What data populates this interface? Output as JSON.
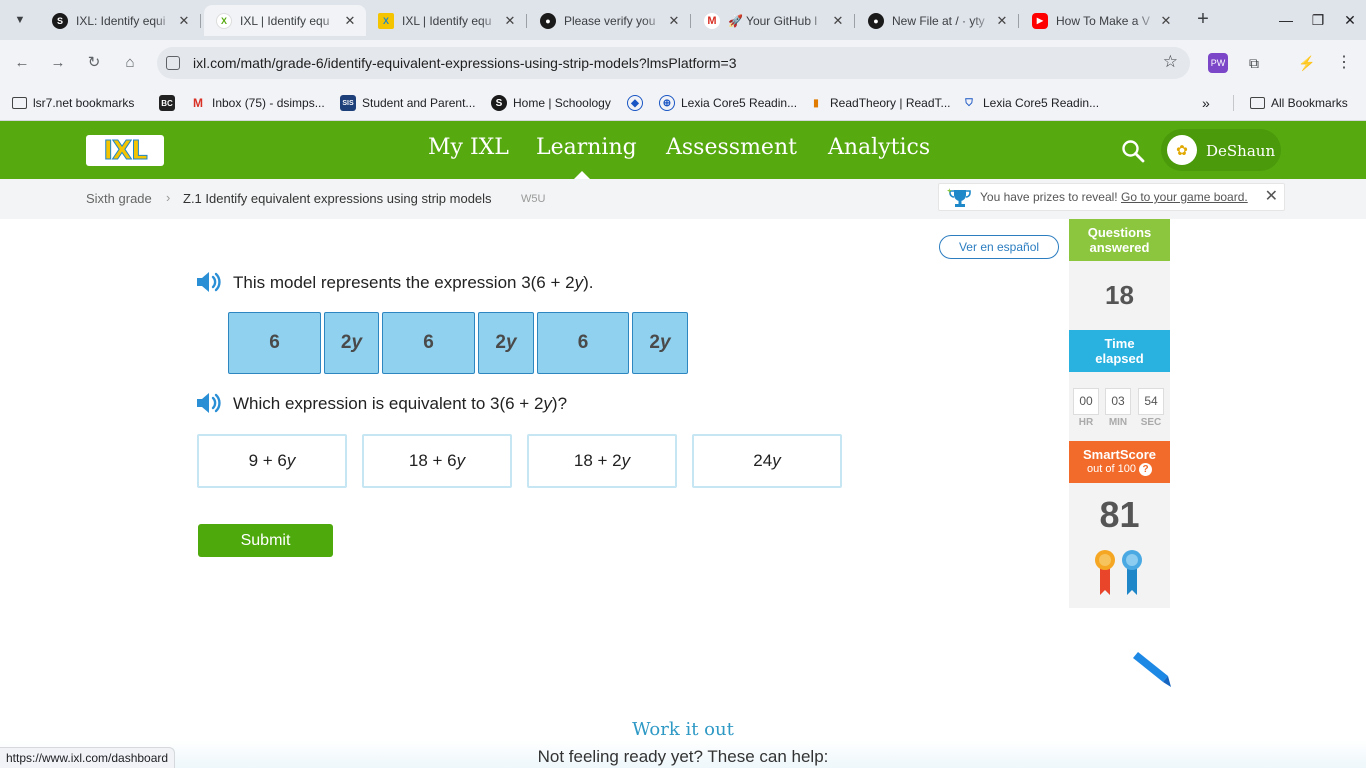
{
  "browser": {
    "tabs": [
      {
        "title": "IXL: Identify equi",
        "icon": "schoology-icon"
      },
      {
        "title": "IXL | Identify equ",
        "icon": "ixl-icon"
      },
      {
        "title": "IXL | Identify equ",
        "icon": "ixl-icon"
      },
      {
        "title": "Please verify you",
        "icon": "github-icon"
      },
      {
        "title": "🚀 Your GitHub l",
        "icon": "gmail-icon"
      },
      {
        "title": "New File at / · yty",
        "icon": "github-icon"
      },
      {
        "title": "How To Make a V",
        "icon": "youtube-icon"
      }
    ],
    "url": "ixl.com/math/grade-6/identify-equivalent-expressions-using-strip-models?lmsPlatform=3",
    "bookmarks": [
      "lsr7.net bookmarks",
      "Inbox (75) - dsimps...",
      "Student and Parent...",
      "Home | Schoology",
      "Lexia Core5 Readin...",
      "ReadTheory | ReadT...",
      "Lexia Core5 Readin..."
    ],
    "all_bookmarks": "All Bookmarks",
    "status_url": "https://www.ixl.com/dashboard"
  },
  "ixl": {
    "logo": "IXL",
    "nav": [
      "My IXL",
      "Learning",
      "Assessment",
      "Analytics"
    ],
    "active_nav": "Learning",
    "user_name": "DeShaun",
    "breadcrumb": {
      "grade": "Sixth grade",
      "skill": "Z.1 Identify equivalent expressions using strip models",
      "code": "W5U"
    },
    "prize": {
      "text": "You have prizes to reveal!",
      "link": "Go to your game board."
    },
    "espanol": "Ver en español"
  },
  "question": {
    "prompt_pre": "This model represents the expression 3(6 + 2",
    "prompt_var": "y",
    "prompt_post": ").",
    "strip": [
      {
        "num": "6",
        "var": ""
      },
      {
        "num": "2",
        "var": "y"
      },
      {
        "num": "6",
        "var": ""
      },
      {
        "num": "2",
        "var": "y"
      },
      {
        "num": "6",
        "var": ""
      },
      {
        "num": "2",
        "var": "y"
      }
    ],
    "ask_pre": "Which expression is equivalent to 3(6 + 2",
    "ask_var": "y",
    "ask_post": ")?",
    "choices": [
      {
        "pre": "9 + 6",
        "var": "y"
      },
      {
        "pre": "18 + 6",
        "var": "y"
      },
      {
        "pre": "18 + 2",
        "var": "y"
      },
      {
        "pre": "24",
        "var": "y"
      }
    ],
    "submit": "Submit"
  },
  "stats": {
    "questions_label_1": "Questions",
    "questions_label_2": "answered",
    "questions_value": "18",
    "time_label_1": "Time",
    "time_label_2": "elapsed",
    "time": {
      "hr": "00",
      "min": "03",
      "sec": "54"
    },
    "time_units": {
      "hr": "HR",
      "min": "MIN",
      "sec": "SEC"
    },
    "smartscore_label": "SmartScore",
    "smartscore_sub": "out of 100",
    "smartscore_help": "?",
    "smartscore_value": "81"
  },
  "footer": {
    "work_it_out": "Work it out",
    "not_ready": "Not feeling ready yet? These can help:"
  },
  "colors": {
    "ixl_green": "#56a90f",
    "strip_fill": "#8fd1ee",
    "questions_header": "#8cc63f",
    "time_header": "#29b1e0",
    "smartscore_header": "#f26b2a"
  }
}
